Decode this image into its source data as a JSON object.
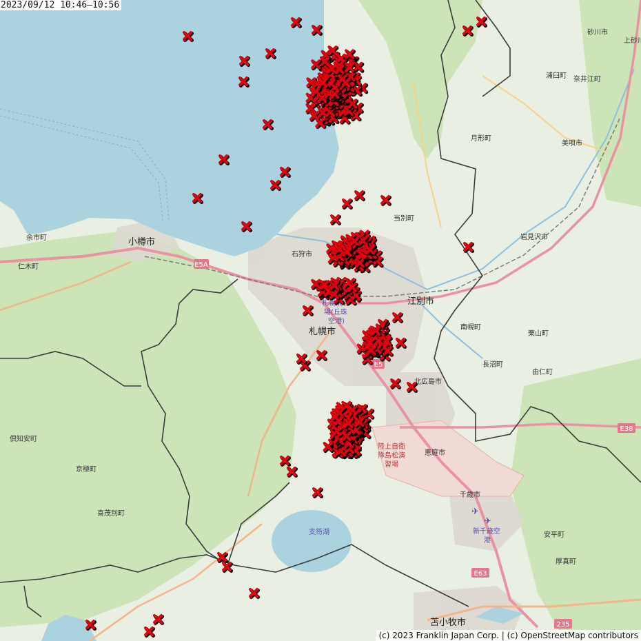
{
  "timestamp": "2023/09/12 10:46–10:56",
  "attribution": "(c) 2023 Franklin Japan Corp. | (c) OpenStreetMap contributors",
  "colors": {
    "sea": "#aad3df",
    "land": "#e9efe2",
    "forest": "#c8dfb0",
    "urban": "#e0dcd6",
    "boundary": "#3b3b3b",
    "marker": "#e3000f"
  },
  "marker_icon": "x-cross-icon",
  "places": [
    {
      "name": "砂川市"
    },
    {
      "name": "上砂川"
    },
    {
      "name": "浦臼町"
    },
    {
      "name": "奈井江町"
    },
    {
      "name": "月形町"
    },
    {
      "name": "美唄市"
    },
    {
      "name": "当別町"
    },
    {
      "name": "岩見沢市"
    },
    {
      "name": "余市町"
    },
    {
      "name": "小樽市"
    },
    {
      "name": "石狩市"
    },
    {
      "name": "仁木町"
    },
    {
      "name": "江別市"
    },
    {
      "name": "札幌市"
    },
    {
      "name": "南幌町"
    },
    {
      "name": "栗山町"
    },
    {
      "name": "長沼町"
    },
    {
      "name": "由仁町"
    },
    {
      "name": "北広島市"
    },
    {
      "name": "倶知安町"
    },
    {
      "name": "京極町"
    },
    {
      "name": "恵庭市"
    },
    {
      "name": "千歳市"
    },
    {
      "name": "喜茂別町"
    },
    {
      "name": "支笏湖"
    },
    {
      "name": "安平町"
    },
    {
      "name": "厚真町"
    },
    {
      "name": "苫小牧市"
    }
  ],
  "poi": [
    {
      "line1": "札幌飛行",
      "line2": "場(丘珠",
      "line3": "空港)"
    },
    {
      "line1": "陸上自衛",
      "line2": "隊島松演",
      "line3": "習場"
    },
    {
      "line1": "新千歳空",
      "line2": "港"
    }
  ],
  "roads": [
    "E5A",
    "E5",
    "E38",
    "E63",
    "235"
  ]
}
